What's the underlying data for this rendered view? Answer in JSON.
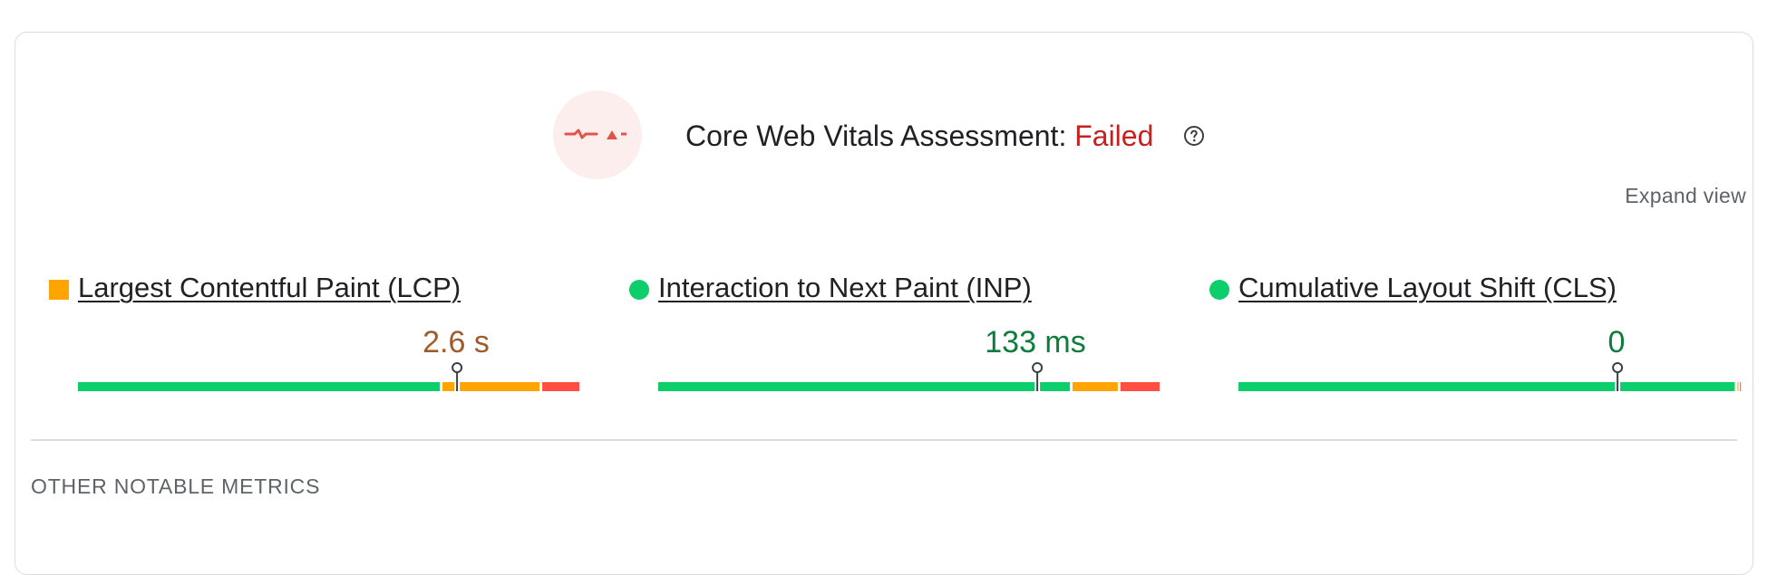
{
  "header": {
    "title_prefix": "Core Web Vitals Assessment: ",
    "status": "Failed",
    "status_color": "#c5221f",
    "badge_icon": "cwv-failed-icon",
    "help_icon": "help-icon"
  },
  "expand_view_label": "Expand view",
  "metrics": [
    {
      "name": "Largest Contentful Paint (LCP)",
      "value": "2.6 s",
      "rating": "needs-improvement",
      "indicator": "square",
      "distribution": [
        0.723,
        0.198,
        0.079
      ],
      "marker_fraction": 0.752
    },
    {
      "name": "Interaction to Next Paint (INP)",
      "value": "133 ms",
      "rating": "good",
      "indicator": "circle",
      "distribution": [
        0.822,
        0.095,
        0.083
      ],
      "marker_fraction": 0.752
    },
    {
      "name": "Cumulative Layout Shift (CLS)",
      "value": "0",
      "rating": "good",
      "indicator": "circle",
      "distribution": [
        0.99,
        0.005,
        0.005
      ],
      "marker_fraction": 0.752
    }
  ],
  "colors": {
    "good": "#0cce6b",
    "needs_improvement": "#ffa400",
    "poor": "#ff4e42"
  },
  "section_heading": "OTHER NOTABLE METRICS"
}
